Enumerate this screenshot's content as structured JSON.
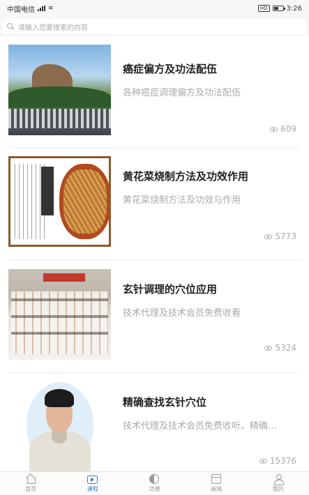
{
  "status_bar": {
    "carrier": "中国电信",
    "network": "4G",
    "time": "3:26",
    "hd_label": "HD"
  },
  "search": {
    "placeholder": "请输入您要搜索的内容"
  },
  "courses": [
    {
      "title": "癌症偏方及功法配伍",
      "description": "各种癌症调理偏方及功法配伍",
      "views": "609",
      "image": "mountain-exercise-photo"
    },
    {
      "title": "黄花菜烧制方法及功效作用",
      "description": "黄花菜烧制方法及功效与作用",
      "views": "5773",
      "image": "daylily-book-photo"
    },
    {
      "title": "玄针调理的穴位应用",
      "description": "技术代理及技术会员免费收看",
      "views": "5324",
      "image": "group-photo"
    },
    {
      "title": "精确查找玄针穴位",
      "description": "技术代理及技术会员免费收听。精确…",
      "views": "15376",
      "image": "instructor-portrait"
    }
  ],
  "tabbar": {
    "items": [
      {
        "label": "首页",
        "icon": "home-icon",
        "active": false
      },
      {
        "label": "课程",
        "icon": "tv-icon",
        "active": true
      },
      {
        "label": "功德",
        "icon": "taiji-icon",
        "active": false
      },
      {
        "label": "商城",
        "icon": "shop-icon",
        "active": false
      },
      {
        "label": "我的",
        "icon": "user-icon",
        "active": false
      }
    ]
  },
  "colors": {
    "accent": "#2b7fd6",
    "muted_text": "#aaaaaa",
    "title_text": "#222222"
  }
}
